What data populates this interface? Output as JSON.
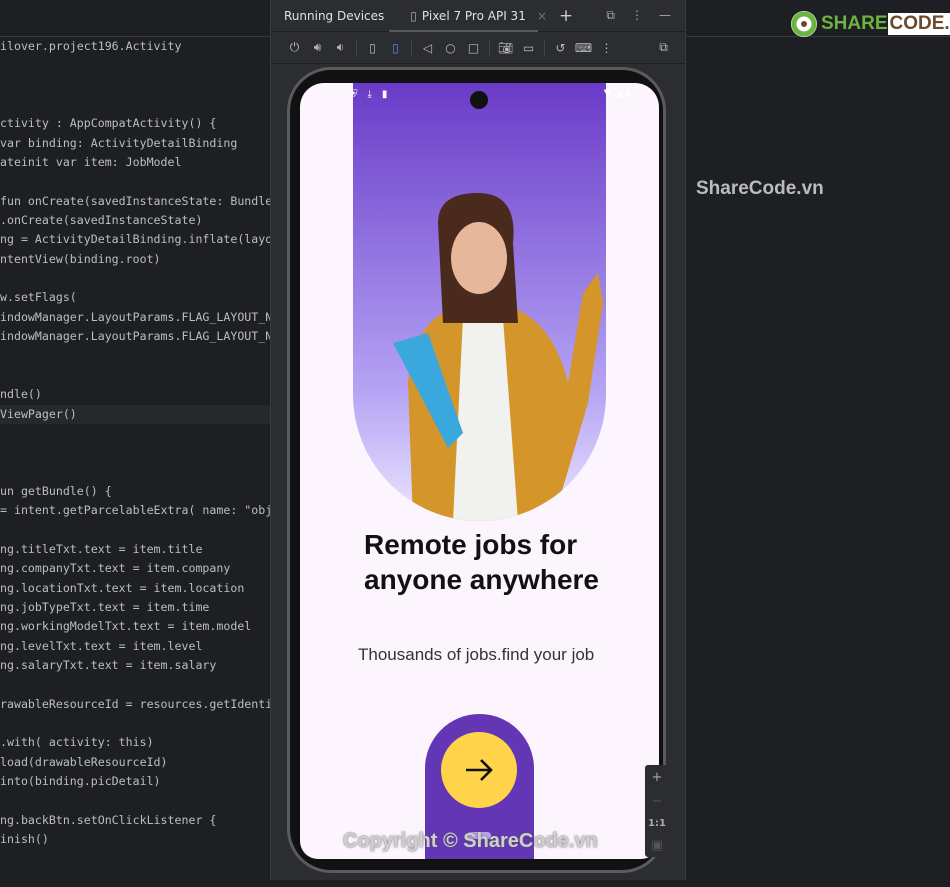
{
  "editor": {
    "lines": [
      "ilover.project196.Activity",
      "",
      "",
      "",
      "ctivity : AppCompatActivity() {",
      "var binding: ActivityDetailBinding",
      "ateinit var item: JobModel",
      "",
      "fun onCreate(savedInstanceState: Bundle",
      ".onCreate(savedInstanceState)",
      "ng = ActivityDetailBinding.inflate(layo",
      "ntentView(binding.root)",
      "",
      "w.setFlags(",
      "indowManager.LayoutParams.FLAG_LAYOUT_N",
      "indowManager.LayoutParams.FLAG_LAYOUT_N",
      "",
      "",
      "ndle()",
      "ViewPager()",
      "",
      "",
      "",
      "un getBundle() {",
      "= intent.getParcelableExtra( name: \"obje",
      "",
      "ng.titleTxt.text = item.title",
      "ng.companyTxt.text = item.company",
      "ng.locationTxt.text = item.location",
      "ng.jobTypeTxt.text = item.time",
      "ng.workingModelTxt.text = item.model",
      "ng.levelTxt.text = item.level",
      "ng.salaryTxt.text = item.salary",
      "",
      "rawableResourceId = resources.getIdenti",
      "",
      ".with( activity: this)",
      "load(drawableResourceId)",
      "into(binding.picDetail)",
      "",
      "ng.backBtn.setOnClickListener {",
      "inish()"
    ]
  },
  "panel": {
    "title": "Running Devices",
    "device_tab": "Pixel 7 Pro API 31"
  },
  "app": {
    "title": "Remote jobs for anyone anywhere",
    "title_line1": "Remote jobs for",
    "title_line2": "anyone anywhere",
    "subtitle": "Thousands of jobs.find your job",
    "accent": "#6236b5",
    "button_color": "#ffd34a"
  },
  "zoom": {
    "in": "+",
    "out": "−",
    "actual": "1:1"
  },
  "watermark": {
    "logo": "SHARECODE.vn",
    "side": "ShareCode.vn",
    "copyright": "Copyright © ShareCode.vn"
  }
}
